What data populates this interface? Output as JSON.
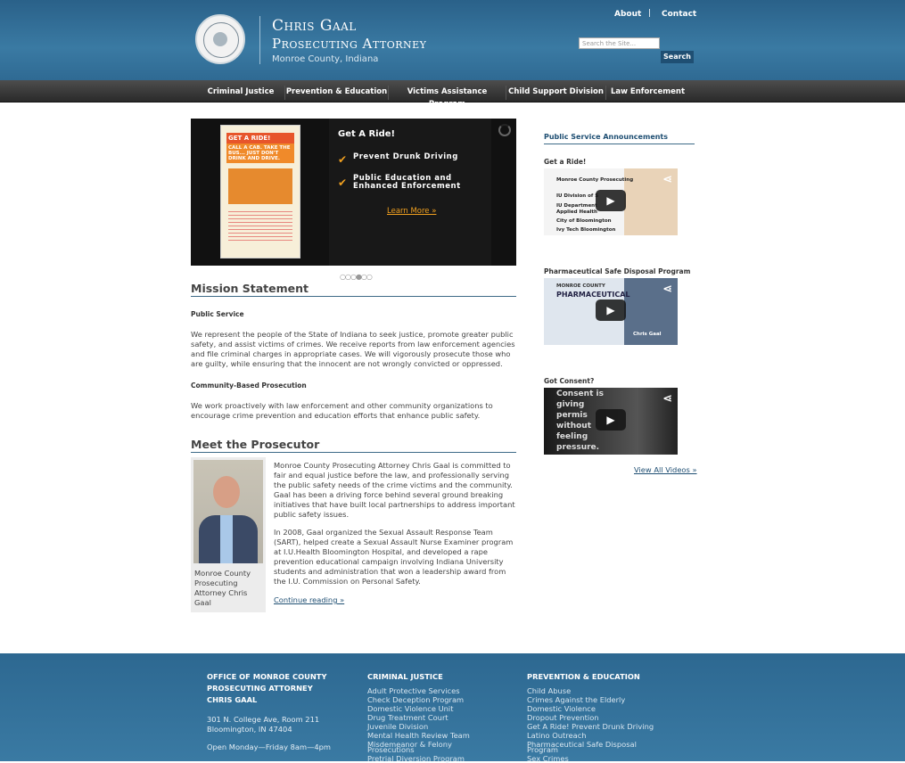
{
  "header": {
    "name_line1": "Chris Gaal",
    "name_line2": "Prosecuting Attorney",
    "county": "Monroe County, Indiana",
    "links": [
      "About",
      "Contact"
    ],
    "separator": "|",
    "search_placeholder": "Search the Site...",
    "search_button": "Search"
  },
  "nav": [
    "Criminal Justice",
    "Prevention & Education",
    "Victims Assistance Program",
    "Child Support Division",
    "Law Enforcement"
  ],
  "slider": {
    "poster_headline": "GET A RIDE!",
    "poster_sub": "CALL A CAB. TAKE THE BUS... JUST DON'T DRINK AND DRIVE.",
    "title": "Get A Ride!",
    "bullets": [
      "Prevent Drunk Driving",
      "Public Education and Enhanced Enforcement"
    ],
    "check_glyph": "✔",
    "learn_more": "Learn More »",
    "dots": "○○○●○○"
  },
  "mission": {
    "heading": "Mission Statement",
    "sub1": "Public Service",
    "para1": "We represent the people of the State of Indiana to seek justice, promote greater public safety, and assist victims of crimes. We receive reports from law enforcement agencies and file criminal charges in appropriate cases. We will vigorously prosecute those who are guilty, while ensuring that the innocent are not wrongly convicted or oppressed.",
    "sub2": "Community-Based Prosecution",
    "para2": "We work proactively with law enforcement and other community organizations to encourage crime prevention and education efforts that enhance public safety."
  },
  "prosecutor": {
    "heading": "Meet the Prosecutor",
    "caption": "Monroe County Prosecuting Attorney Chris Gaal",
    "para1": "Monroe County Prosecuting Attorney Chris Gaal is committed to fair and equal justice before the law, and professionally serving the public safety needs of the crime victims and the community. Gaal has been a driving force behind several ground breaking initiatives that have built local partnerships to address important public safety issues.",
    "para2": "In 2008, Gaal organized the Sexual Assault Response Team (SART), helped create a Sexual Assault Nurse Examiner program at I.U.Health Bloomington Hospital, and developed a rape prevention educational campaign involving Indiana University students and administration that won a leadership award from the I.U. Commission on Personal Safety.",
    "continue": "Continue reading »"
  },
  "sidebar": {
    "heading": "Public Service Announcements",
    "videos": [
      {
        "label": "Get a Ride!",
        "lines": [
          "Monroe County Prosecuting",
          "IU Division of S",
          "IU Department",
          "Applied Health",
          "City of Bloomington",
          "Ivy Tech Bloomington"
        ]
      },
      {
        "label": "Pharmaceutical Safe Disposal Program",
        "lines": [
          "MONROE COUNTY",
          "PHARMACEUTICAL",
          "Chris Gaal"
        ]
      },
      {
        "label": "Got Consent?",
        "lines": [
          "Consent is",
          "giving",
          "permis",
          "without",
          "feeling",
          "pressure."
        ]
      }
    ],
    "play_glyph": "▶",
    "share_glyph": "⋖",
    "view_all": "View All Videos »"
  },
  "footer": {
    "office": [
      "OFFICE OF MONROE COUNTY",
      "PROSECUTING ATTORNEY",
      "CHRIS GAAL"
    ],
    "address": [
      "301 N. College Ave, Room 211",
      "Bloomington, IN 47404"
    ],
    "hours": "Open Monday—Friday 8am—4pm",
    "cj_heading": "CRIMINAL JUSTICE",
    "cj_items": [
      "Adult Protective Services",
      "Check Deception Program",
      "Domestic Violence Unit",
      "Drug Treatment Court",
      "Juvenile Division",
      "Mental Health Review Team",
      "Misdemeanor & Felony",
      "Prosecutions",
      "Pretrial Diversion Program"
    ],
    "pe_heading": "PREVENTION & EDUCATION",
    "pe_items": [
      "Child Abuse",
      "Crimes Against the Elderly",
      "Domestic Violence",
      "Dropout Prevention",
      "Get A Ride! Prevent Drunk Driving",
      "Latino Outreach",
      "Pharmaceutical Safe Disposal",
      "Program",
      "Sex Crimes"
    ]
  }
}
